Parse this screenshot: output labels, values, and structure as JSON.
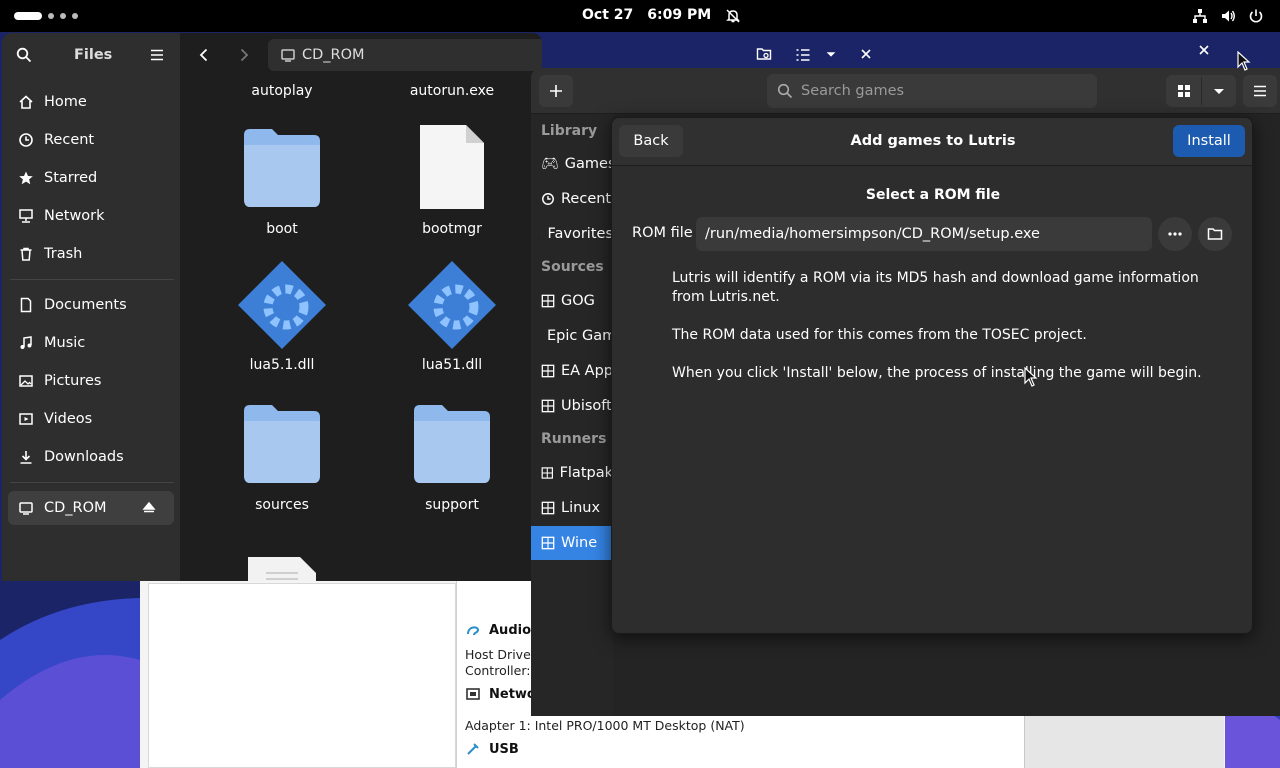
{
  "topbar": {
    "date": "Oct 27",
    "time": "6:09 PM",
    "icons": [
      "activities-indicator",
      "notifications-off-icon",
      "network-icon",
      "volume-icon",
      "power-icon"
    ]
  },
  "files": {
    "title": "Files",
    "path": "CD_ROM",
    "sidebar": [
      {
        "label": "Home",
        "icon": "home-icon"
      },
      {
        "label": "Recent",
        "icon": "clock-icon"
      },
      {
        "label": "Starred",
        "icon": "star-icon"
      },
      {
        "label": "Network",
        "icon": "network-icon"
      },
      {
        "label": "Trash",
        "icon": "trash-icon"
      },
      {
        "label": "Documents",
        "icon": "document-icon"
      },
      {
        "label": "Music",
        "icon": "music-icon"
      },
      {
        "label": "Pictures",
        "icon": "picture-icon"
      },
      {
        "label": "Videos",
        "icon": "video-icon"
      },
      {
        "label": "Downloads",
        "icon": "download-icon"
      }
    ],
    "device": {
      "label": "CD_ROM",
      "icon": "drive-icon"
    },
    "items": [
      {
        "label": "autoplay",
        "icon": "file"
      },
      {
        "label": "autorun.exe",
        "icon": "file"
      },
      {
        "label": "boot",
        "icon": "folder"
      },
      {
        "label": "bootmgr",
        "icon": "file"
      },
      {
        "label": "lua5.1.dll",
        "icon": "dll"
      },
      {
        "label": "lua51.dll",
        "icon": "dll"
      },
      {
        "label": "sources",
        "icon": "folder"
      },
      {
        "label": "support",
        "icon": "folder"
      }
    ]
  },
  "lutris": {
    "search_placeholder": "Search games",
    "sidebar": {
      "library_header": "Library",
      "library": [
        "Games",
        "Recent",
        "Favorites"
      ],
      "sources_header": "Sources",
      "sources": [
        "GOG",
        "Epic Games",
        "EA App",
        "Ubisoft"
      ],
      "runners_header": "Runners",
      "runners": [
        "Flatpak",
        "Linux",
        "Wine"
      ]
    }
  },
  "dialog": {
    "back_label": "Back",
    "title": "Add games to Lutris",
    "install_label": "Install",
    "heading": "Select a ROM file",
    "rom_label": "ROM file",
    "rom_value": "/run/media/homersimpson/CD_ROM/setup.exe",
    "paragraphs": [
      "Lutris will identify a ROM via its MD5 hash and download game information from Lutris.net.",
      "The ROM data used for this comes from the TOSEC project.",
      "When you click 'Install' below, the process of installing the game will begin."
    ]
  },
  "vbox": {
    "audio_title": "Audio",
    "audio_lines": [
      "Host Driver:",
      "Controller:"
    ],
    "network_title": "Network",
    "network_line": "Adapter 1:   Intel PRO/1000 MT Desktop (NAT)",
    "usb_title": "USB"
  },
  "colors": {
    "accent": "#3584e4",
    "install_button": "#1c5bb0",
    "folder": "#a8c8f0",
    "dll": "#3d7fd6"
  }
}
